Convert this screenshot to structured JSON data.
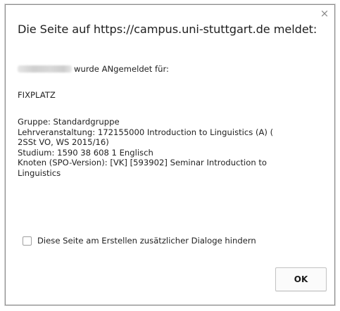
{
  "dialog": {
    "title": "Die Seite auf https://campus.uni-stuttgart.de meldet:",
    "close_icon": "×",
    "registered_text": "wurde ANgemeldet für:",
    "placement": "FIXPLATZ",
    "details": [
      "Gruppe: Standardgruppe",
      "Lehrveranstaltung: 172155000 Introduction to Linguistics (A) (",
      "2SSt VO, WS 2015/16)",
      "Studium: 1590 38 608 1 Englisch",
      "Knoten (SPO-Version): [VK]  [593902] Seminar Introduction to",
      "Linguistics"
    ],
    "checkbox_label": "Diese Seite am Erstellen zusätzlicher Dialoge hindern",
    "checkbox_checked": false,
    "ok_label": "OK"
  },
  "icons": {
    "close": "close-icon"
  }
}
